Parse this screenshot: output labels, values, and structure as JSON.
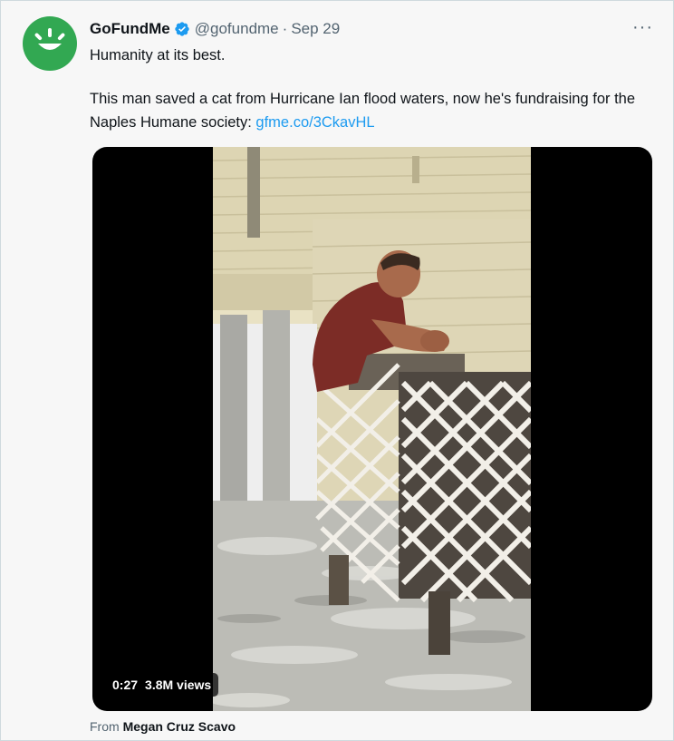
{
  "author": {
    "name": "GoFundMe",
    "handle": "@gofundme",
    "separator": "·",
    "date": "Sep 29",
    "avatar_color": "#32a852",
    "verified_color": "#1d9bf0"
  },
  "more_icon": "more-horizontal-icon",
  "more_label": "···",
  "text": {
    "line1": "Humanity at its best.",
    "line2": "This man saved a cat from Hurricane Ian flood waters, now he's fundraising for the Naples Humane society: ",
    "link": "gfme.co/3CkavHL"
  },
  "video": {
    "time": "0:27",
    "views": "3.8M views"
  },
  "source": {
    "prefix": "From ",
    "name": "Megan Cruz Scavo"
  }
}
